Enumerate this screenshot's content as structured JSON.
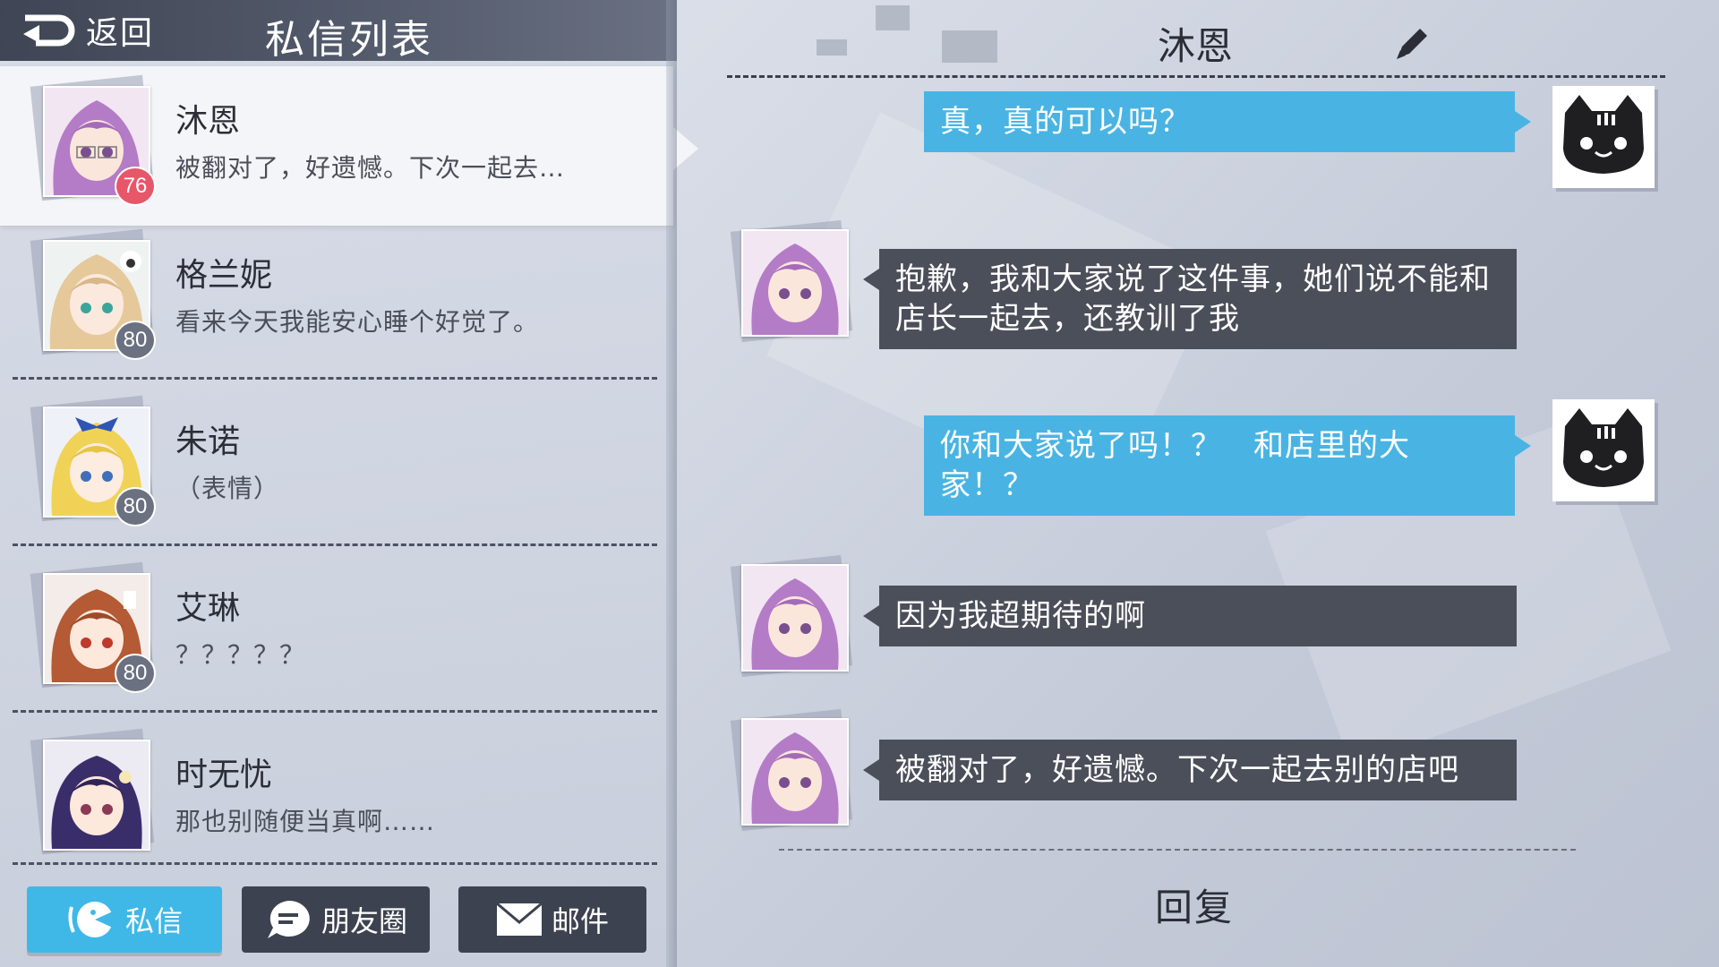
{
  "header": {
    "back_label": "返回",
    "title": "私信列表"
  },
  "contacts": [
    {
      "name": "沐恩",
      "preview": "被翻对了，好遗憾。下次一起去…",
      "level": "76",
      "hair": "#b47cc7"
    },
    {
      "name": "格兰妮",
      "preview": "看来今天我能安心睡个好觉了。",
      "level": "80",
      "hair": "#e6c99a"
    },
    {
      "name": "朱诺",
      "preview": "（表情）",
      "level": "80",
      "hair": "#f0d257"
    },
    {
      "name": "艾琳",
      "preview": "？？？？？",
      "level": "80",
      "hair": "#b45a34"
    },
    {
      "name": "时无忧",
      "preview": "那也别随便当真啊……",
      "level": "",
      "hair": "#3a2e6a"
    }
  ],
  "tabs": {
    "private": "私信",
    "moments": "朋友圈",
    "mail": "邮件"
  },
  "chat": {
    "title": "沐恩",
    "messages": [
      {
        "from": "me",
        "text": "真，真的可以吗？"
      },
      {
        "from": "her",
        "text": "抱歉，我和大家说了这件事，她们说不能和店长一起去，还教训了我"
      },
      {
        "from": "me",
        "text": "你和大家说了吗！？　和店里的大家！？"
      },
      {
        "from": "her",
        "text": "因为我超期待的啊"
      },
      {
        "from": "her",
        "text": "被翻对了，好遗憾。下次一起去别的店吧"
      }
    ],
    "reply_label": "回复"
  },
  "colors": {
    "accent": "#3fb8e8",
    "bubble_me": "#49b4e3",
    "bubble_her": "#4b4f5a",
    "badge_hot": "#e8566a"
  }
}
